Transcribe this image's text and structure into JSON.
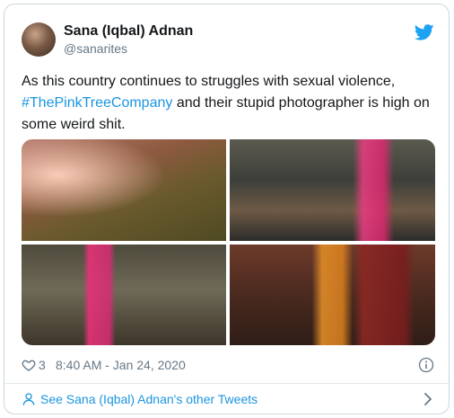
{
  "author": {
    "display_name": "Sana (Iqbal) Adnan",
    "handle": "@sanarites"
  },
  "tweet": {
    "text_before": "As this country continues to struggles with sexual violence,",
    "hashtag": "#ThePinkTreeCompany",
    "text_after": " and their stupid photographer is high on some weird shit."
  },
  "stats": {
    "likes": "3",
    "timestamp": "8:40 AM - Jan 24, 2020"
  },
  "footer": {
    "link_text": "See Sana (Iqbal) Adnan's other Tweets"
  },
  "icons": {
    "brand": "twitter-icon",
    "like": "heart-icon",
    "info": "info-icon",
    "profile": "person-icon",
    "more": "chevron-right-icon"
  },
  "colors": {
    "link": "#1b95e0",
    "twitter_blue": "#1da1f2",
    "muted": "#657786",
    "text": "#14171a"
  }
}
